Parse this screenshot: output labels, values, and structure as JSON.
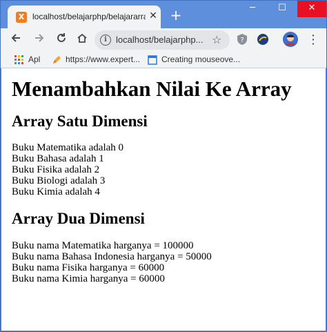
{
  "browser": {
    "tab_title": "localhost/belajarphp/belajararray",
    "tab_favicon_label": "X",
    "url": "localhost/belajarphp...",
    "colors": {
      "tabstrip": "#5e8fdd",
      "close_button": "#e81123"
    }
  },
  "bookmarks": [
    {
      "label": "Apl",
      "icon": "apps-grid-icon"
    },
    {
      "label": "https://www.expert...",
      "icon": "pen-icon"
    },
    {
      "label": "Creating mouseove...",
      "icon": "page-icon"
    }
  ],
  "page": {
    "heading": "Menambahkan Nilai Ke Array",
    "section1_title": "Array Satu Dimensi",
    "section1_lines": [
      "Buku Matematika adalah 0",
      "Buku Bahasa adalah 1",
      "Buku Fisika adalah 2",
      "Buku Biologi adalah 3",
      "Buku Kimia adalah 4"
    ],
    "section2_title": "Array Dua Dimensi",
    "section2_lines": [
      "Buku nama Matematika harganya = 100000",
      "Buku nama Bahasa Indonesia harganya = 50000",
      "Buku nama Fisika harganya = 60000",
      "Buku nama Kimia harganya = 60000"
    ]
  }
}
